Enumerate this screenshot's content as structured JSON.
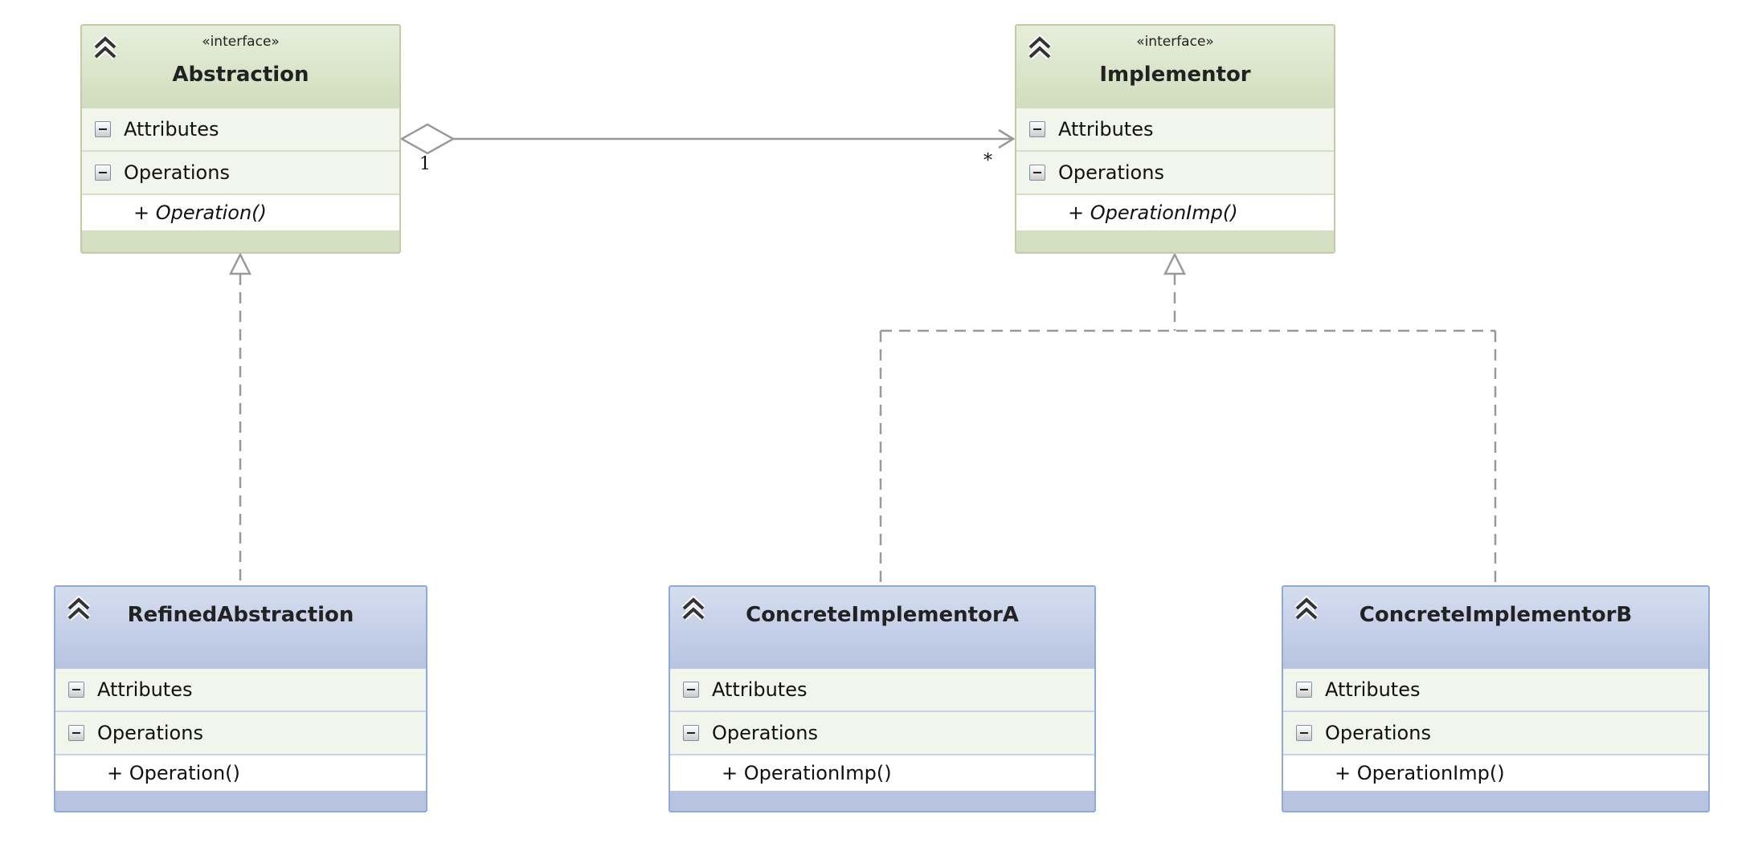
{
  "classes": [
    {
      "id": "abstraction",
      "stereotype": "«interface»",
      "name": "Abstraction",
      "attributes_label": "Attributes",
      "operations_label": "Operations",
      "operations": [
        "+ Operation()"
      ],
      "kind": "interface"
    },
    {
      "id": "implementor",
      "stereotype": "«interface»",
      "name": "Implementor",
      "attributes_label": "Attributes",
      "operations_label": "Operations",
      "operations": [
        "+ OperationImp()"
      ],
      "kind": "interface"
    },
    {
      "id": "refined-abstraction",
      "name": "RefinedAbstraction",
      "attributes_label": "Attributes",
      "operations_label": "Operations",
      "operations": [
        "+ Operation()"
      ],
      "kind": "class"
    },
    {
      "id": "concrete-implementor-a",
      "name": "ConcreteImplementorA",
      "attributes_label": "Attributes",
      "operations_label": "Operations",
      "operations": [
        "+ OperationImp()"
      ],
      "kind": "class"
    },
    {
      "id": "concrete-implementor-b",
      "name": "ConcreteImplementorB",
      "attributes_label": "Attributes",
      "operations_label": "Operations",
      "operations": [
        "+ OperationImp()"
      ],
      "kind": "class"
    }
  ],
  "relations": [
    {
      "type": "aggregation",
      "from": "Abstraction",
      "to": "Implementor",
      "from_multiplicity": "1",
      "to_multiplicity": "*"
    },
    {
      "type": "realization",
      "from": "RefinedAbstraction",
      "to": "Abstraction"
    },
    {
      "type": "realization",
      "from": "ConcreteImplementorA",
      "to": "Implementor"
    },
    {
      "type": "realization",
      "from": "ConcreteImplementorB",
      "to": "Implementor"
    }
  ],
  "colors": {
    "interface_header": "#d1ddbd",
    "class_header": "#b7c3e1",
    "line": "#999999"
  }
}
